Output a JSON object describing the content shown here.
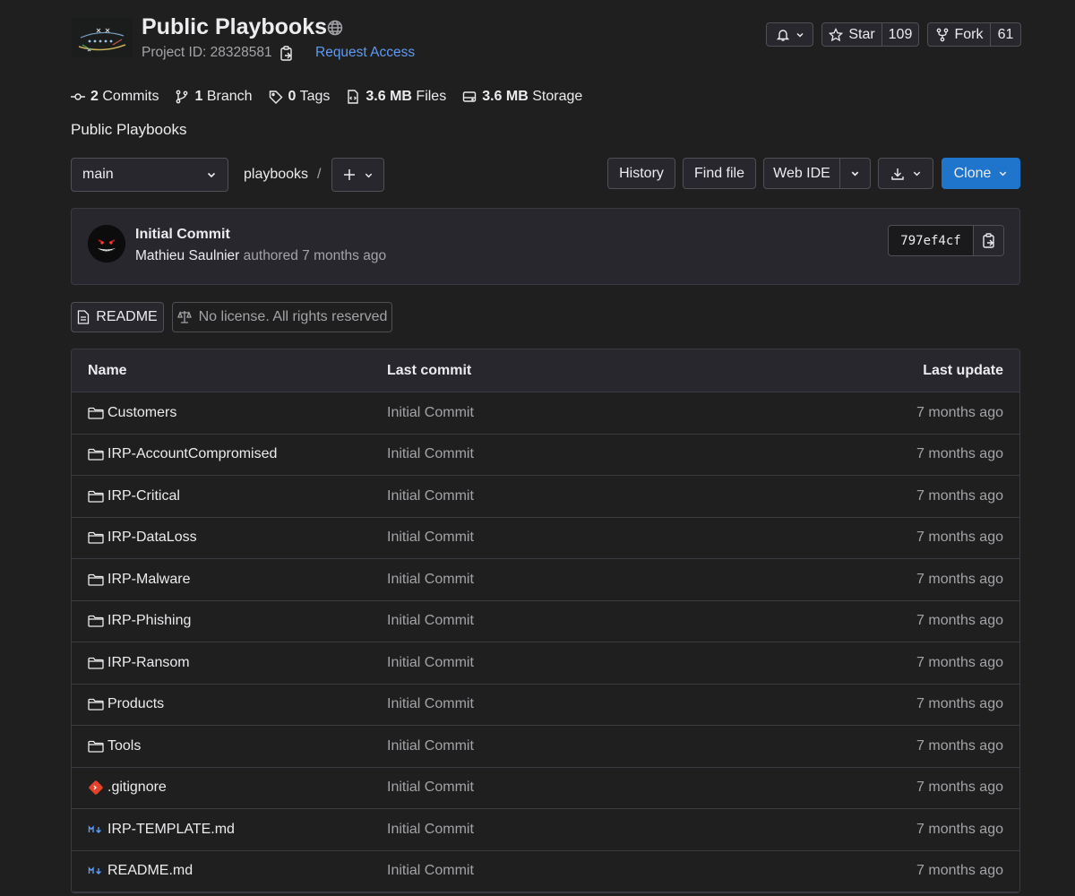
{
  "project": {
    "title": "Public Playbooks",
    "id_label": "Project ID: 28328581",
    "request_access": "Request Access",
    "description": "Public Playbooks"
  },
  "actions": {
    "star_label": "Star",
    "star_count": "109",
    "fork_label": "Fork",
    "fork_count": "61"
  },
  "stats": {
    "commits_count": "2",
    "commits_label": "Commits",
    "branch_count": "1",
    "branch_label": "Branch",
    "tags_count": "0",
    "tags_label": "Tags",
    "files_size": "3.6 MB",
    "files_label": "Files",
    "storage_size": "3.6 MB",
    "storage_label": "Storage"
  },
  "toolbar": {
    "branch": "main",
    "path": "playbooks",
    "path_sep": "/",
    "history": "History",
    "find_file": "Find file",
    "web_ide": "Web IDE",
    "clone": "Clone"
  },
  "last_commit": {
    "title": "Initial Commit",
    "author": "Mathieu Saulnier",
    "meta": "authored 7 months ago",
    "sha": "797ef4cf"
  },
  "badges": {
    "readme": "README",
    "license": "No license. All rights reserved"
  },
  "table": {
    "headers": {
      "name": "Name",
      "last_commit": "Last commit",
      "last_update": "Last update"
    },
    "rows": [
      {
        "name": "Customers",
        "type": "folder-icon",
        "commit": "Initial Commit",
        "updated": "7 months ago"
      },
      {
        "name": "IRP-AccountCompromised",
        "type": "folder-icon",
        "commit": "Initial Commit",
        "updated": "7 months ago"
      },
      {
        "name": "IRP-Critical",
        "type": "folder-icon",
        "commit": "Initial Commit",
        "updated": "7 months ago"
      },
      {
        "name": "IRP-DataLoss",
        "type": "folder-icon",
        "commit": "Initial Commit",
        "updated": "7 months ago"
      },
      {
        "name": "IRP-Malware",
        "type": "folder-icon",
        "commit": "Initial Commit",
        "updated": "7 months ago"
      },
      {
        "name": "IRP-Phishing",
        "type": "folder-icon",
        "commit": "Initial Commit",
        "updated": "7 months ago"
      },
      {
        "name": "IRP-Ransom",
        "type": "folder-icon",
        "commit": "Initial Commit",
        "updated": "7 months ago"
      },
      {
        "name": "Products",
        "type": "folder-icon",
        "commit": "Initial Commit",
        "updated": "7 months ago"
      },
      {
        "name": "Tools",
        "type": "folder-icon",
        "commit": "Initial Commit",
        "updated": "7 months ago"
      },
      {
        "name": ".gitignore",
        "type": "git-icon",
        "commit": "Initial Commit",
        "updated": "7 months ago"
      },
      {
        "name": "IRP-TEMPLATE.md",
        "type": "markdown-icon",
        "commit": "Initial Commit",
        "updated": "7 months ago"
      },
      {
        "name": "README.md",
        "type": "markdown-icon",
        "commit": "Initial Commit",
        "updated": "7 months ago"
      }
    ]
  },
  "colors": {
    "background": "#1f1f1f",
    "surface": "#28272d",
    "border": "#4f4f55",
    "link": "#5d9bf5",
    "primary_button": "#1f75cb",
    "git_icon": "#e24329",
    "markdown_icon": "#5d9bf5"
  }
}
